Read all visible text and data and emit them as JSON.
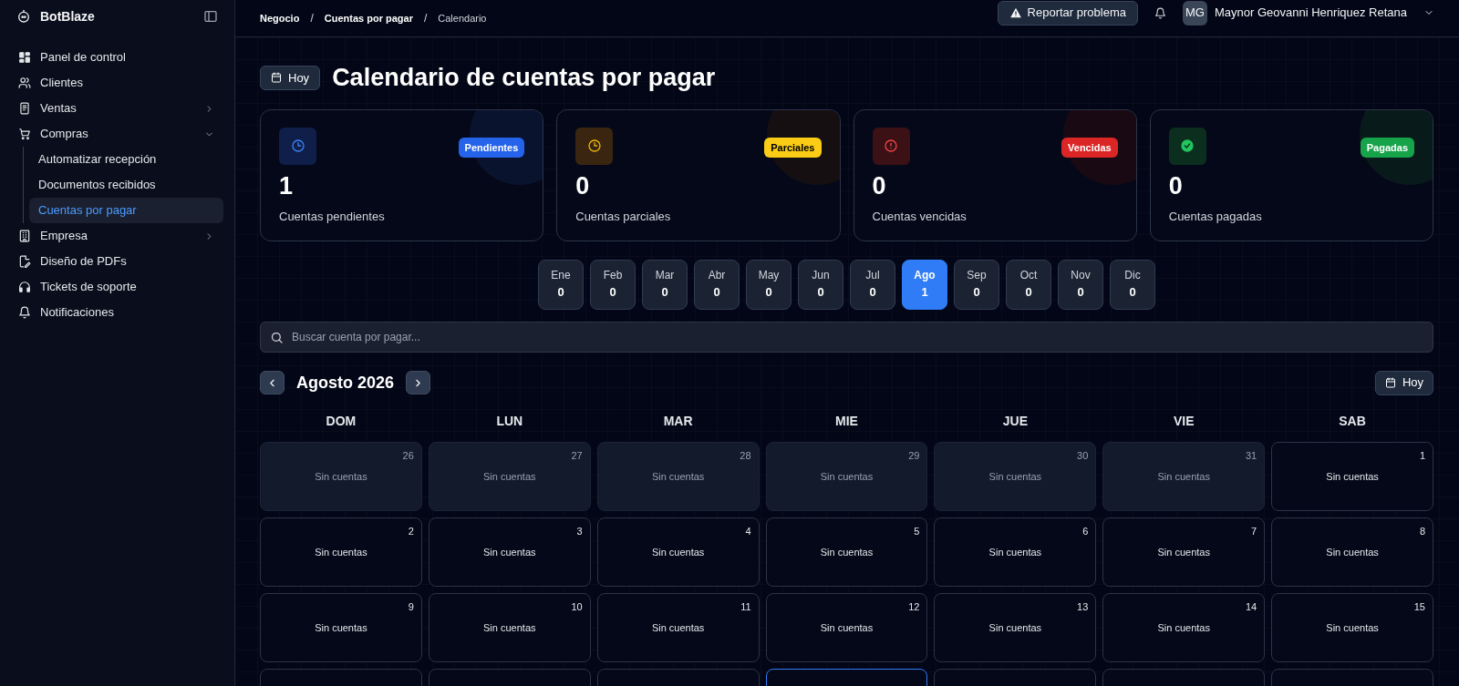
{
  "sidebar": {
    "brand": "BotBlaze",
    "items": [
      {
        "label": "Panel de control",
        "selected": false
      },
      {
        "label": "Clientes",
        "selected": false
      },
      {
        "label": "Ventas",
        "selected": false,
        "expanded": false
      },
      {
        "label": "Compras",
        "selected": false,
        "expanded": true,
        "children": [
          {
            "label": "Automatizar recepción",
            "selected": false
          },
          {
            "label": "Documentos recibidos",
            "selected": false
          },
          {
            "label": "Cuentas por pagar",
            "selected": true
          }
        ]
      },
      {
        "label": "Empresa",
        "selected": false,
        "expanded": false
      },
      {
        "label": "Diseño de PDFs",
        "selected": false
      },
      {
        "label": "Tickets de soporte",
        "selected": false
      },
      {
        "label": "Notificaciones",
        "selected": false
      }
    ]
  },
  "header": {
    "breadcrumbs": [
      "Negocio",
      "Cuentas por pagar",
      "Calendario"
    ],
    "breadcrumb_separators": [
      "/",
      "/"
    ],
    "report_button": "Reportar problema",
    "user": {
      "initials": "MG",
      "name": "Maynor Geovanni Henriquez Retana"
    }
  },
  "page": {
    "today_button": "Hoy",
    "title": "Calendario de cuentas por pagar"
  },
  "stats": [
    {
      "kind": "pending",
      "badge": "Pendientes",
      "count": "1",
      "label": "Cuentas pendientes",
      "color": "#2563eb"
    },
    {
      "kind": "partial",
      "badge": "Parciales",
      "count": "0",
      "label": "Cuentas parciales",
      "color": "#facc15"
    },
    {
      "kind": "overdue",
      "badge": "Vencidas",
      "count": "0",
      "label": "Cuentas vencidas",
      "color": "#dc2626"
    },
    {
      "kind": "paid",
      "badge": "Pagadas",
      "count": "0",
      "label": "Cuentas pagadas",
      "color": "#16a34a"
    }
  ],
  "months": [
    {
      "label": "Ene",
      "count": "0",
      "selected": false
    },
    {
      "label": "Feb",
      "count": "0",
      "selected": false
    },
    {
      "label": "Mar",
      "count": "0",
      "selected": false
    },
    {
      "label": "Abr",
      "count": "0",
      "selected": false
    },
    {
      "label": "May",
      "count": "0",
      "selected": false
    },
    {
      "label": "Jun",
      "count": "0",
      "selected": false
    },
    {
      "label": "Jul",
      "count": "0",
      "selected": false
    },
    {
      "label": "Ago",
      "count": "1",
      "selected": true
    },
    {
      "label": "Sep",
      "count": "0",
      "selected": false
    },
    {
      "label": "Oct",
      "count": "0",
      "selected": false
    },
    {
      "label": "Nov",
      "count": "0",
      "selected": false
    },
    {
      "label": "Dic",
      "count": "0",
      "selected": false
    }
  ],
  "search": {
    "placeholder": "Buscar cuenta por pagar..."
  },
  "calendar": {
    "month_label": "Agosto 2026",
    "today_button": "Hoy",
    "weekdays": [
      "DOM",
      "LUN",
      "MAR",
      "MIE",
      "JUE",
      "VIE",
      "SAB"
    ],
    "weeks": [
      [
        {
          "day": "26",
          "text": "Sin cuentas",
          "outside": true
        },
        {
          "day": "27",
          "text": "Sin cuentas",
          "outside": true
        },
        {
          "day": "28",
          "text": "Sin cuentas",
          "outside": true
        },
        {
          "day": "29",
          "text": "Sin cuentas",
          "outside": true
        },
        {
          "day": "30",
          "text": "Sin cuentas",
          "outside": true
        },
        {
          "day": "31",
          "text": "Sin cuentas",
          "outside": true
        },
        {
          "day": "1",
          "text": "Sin cuentas",
          "outside": false
        }
      ],
      [
        {
          "day": "2",
          "text": "Sin cuentas",
          "outside": false
        },
        {
          "day": "3",
          "text": "Sin cuentas",
          "outside": false
        },
        {
          "day": "4",
          "text": "Sin cuentas",
          "outside": false
        },
        {
          "day": "5",
          "text": "Sin cuentas",
          "outside": false
        },
        {
          "day": "6",
          "text": "Sin cuentas",
          "outside": false
        },
        {
          "day": "7",
          "text": "Sin cuentas",
          "outside": false
        },
        {
          "day": "8",
          "text": "Sin cuentas",
          "outside": false
        }
      ],
      [
        {
          "day": "9",
          "text": "Sin cuentas",
          "outside": false
        },
        {
          "day": "10",
          "text": "Sin cuentas",
          "outside": false
        },
        {
          "day": "11",
          "text": "Sin cuentas",
          "outside": false
        },
        {
          "day": "12",
          "text": "Sin cuentas",
          "outside": false
        },
        {
          "day": "13",
          "text": "Sin cuentas",
          "outside": false
        },
        {
          "day": "14",
          "text": "Sin cuentas",
          "outside": false
        },
        {
          "day": "15",
          "text": "Sin cuentas",
          "outside": false
        }
      ]
    ],
    "cut_week": [
      {
        "today": false
      },
      {
        "today": false
      },
      {
        "today": false
      },
      {
        "today": true
      },
      {
        "today": false
      },
      {
        "today": false
      },
      {
        "today": false
      }
    ]
  }
}
